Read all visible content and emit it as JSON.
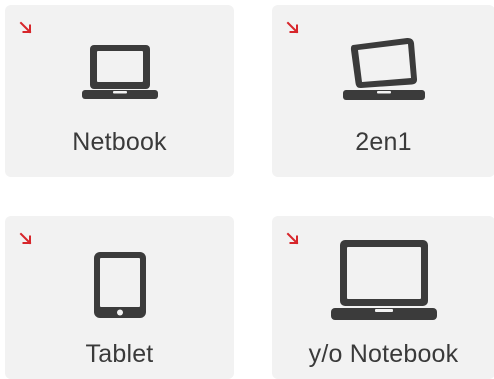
{
  "accent_color": "#d7262b",
  "icon_color": "#3b3b3b",
  "cards": [
    {
      "label": "Netbook",
      "icon": "netbook-icon",
      "corner_icon": "arrow-down-right-icon"
    },
    {
      "label": "2en1",
      "icon": "two-in-one-icon",
      "corner_icon": "arrow-down-right-icon"
    },
    {
      "label": "Tablet",
      "icon": "tablet-icon",
      "corner_icon": "arrow-down-right-icon"
    },
    {
      "label": "y/o Notebook",
      "icon": "notebook-icon",
      "corner_icon": "arrow-down-right-icon"
    }
  ]
}
